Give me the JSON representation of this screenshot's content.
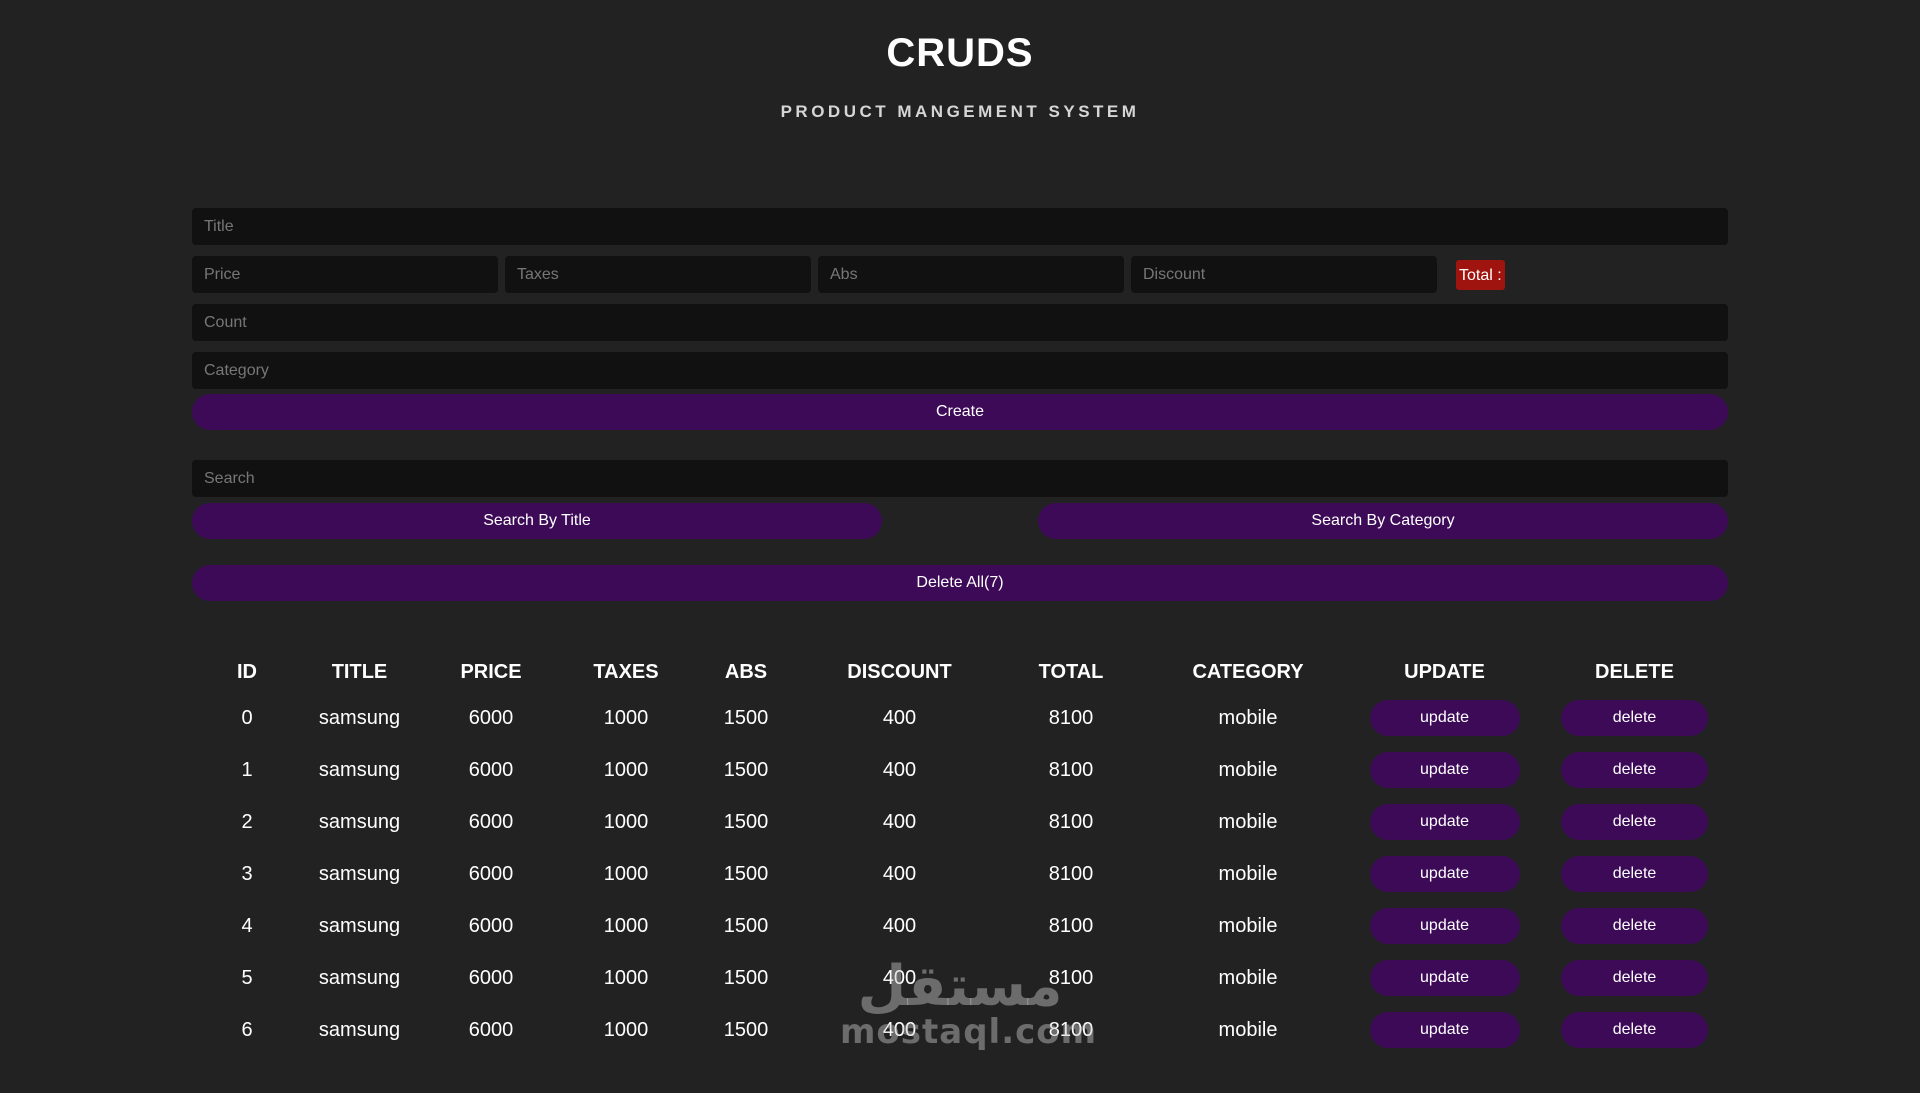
{
  "header": {
    "title": "CRUDS",
    "subtitle": "PRODUCT MANGEMENT SYSTEM"
  },
  "form": {
    "title_placeholder": "Title",
    "price_placeholder": "Price",
    "taxes_placeholder": "Taxes",
    "abs_placeholder": "Abs",
    "discount_placeholder": "Discount",
    "total_label": "Total :",
    "count_placeholder": "Count",
    "category_placeholder": "Category",
    "create_label": "Create"
  },
  "search": {
    "placeholder": "Search",
    "by_title_label": "Search By Title",
    "by_category_label": "Search By Category"
  },
  "delete_all_label": "Delete All(7)",
  "table": {
    "columns": [
      "ID",
      "TITLE",
      "PRICE",
      "TAXES",
      "ABS",
      "DISCOUNT",
      "TOTAL",
      "CATEGORY",
      "UPDATE",
      "DELETE"
    ],
    "rows": [
      {
        "id": "0",
        "title": "samsung",
        "price": "6000",
        "taxes": "1000",
        "abs": "1500",
        "discount": "400",
        "total": "8100",
        "category": "mobile",
        "update": "update",
        "delete": "delete"
      },
      {
        "id": "1",
        "title": "samsung",
        "price": "6000",
        "taxes": "1000",
        "abs": "1500",
        "discount": "400",
        "total": "8100",
        "category": "mobile",
        "update": "update",
        "delete": "delete"
      },
      {
        "id": "2",
        "title": "samsung",
        "price": "6000",
        "taxes": "1000",
        "abs": "1500",
        "discount": "400",
        "total": "8100",
        "category": "mobile",
        "update": "update",
        "delete": "delete"
      },
      {
        "id": "3",
        "title": "samsung",
        "price": "6000",
        "taxes": "1000",
        "abs": "1500",
        "discount": "400",
        "total": "8100",
        "category": "mobile",
        "update": "update",
        "delete": "delete"
      },
      {
        "id": "4",
        "title": "samsung",
        "price": "6000",
        "taxes": "1000",
        "abs": "1500",
        "discount": "400",
        "total": "8100",
        "category": "mobile",
        "update": "update",
        "delete": "delete"
      },
      {
        "id": "5",
        "title": "samsung",
        "price": "6000",
        "taxes": "1000",
        "abs": "1500",
        "discount": "400",
        "total": "8100",
        "category": "mobile",
        "update": "update",
        "delete": "delete"
      },
      {
        "id": "6",
        "title": "samsung",
        "price": "6000",
        "taxes": "1000",
        "abs": "1500",
        "discount": "400",
        "total": "8100",
        "category": "mobile",
        "update": "update",
        "delete": "delete"
      }
    ]
  },
  "watermark": {
    "arabic": "مستقل",
    "latin": "mostaql.com"
  },
  "colors": {
    "background": "#222222",
    "input_background": "#111111",
    "button_purple": "#3d0a58",
    "total_red": "#a0140f",
    "text": "#ffffff"
  }
}
